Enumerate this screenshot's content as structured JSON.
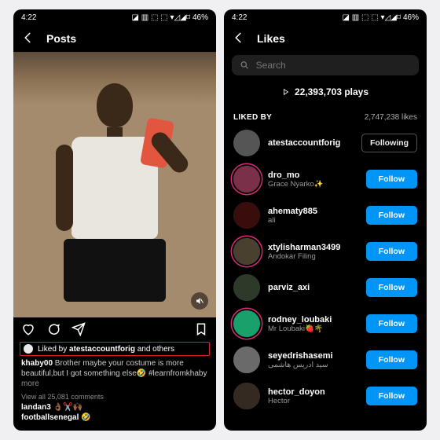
{
  "status": {
    "time": "4:22",
    "battery": "46%",
    "net_icons": "◪ ▥ ⬚ ⬚ ▾◿◢⌑"
  },
  "left": {
    "header_title": "Posts",
    "liked_prefix": "Liked by ",
    "liked_user": "atestaccountforig",
    "liked_suffix": " and others",
    "caption_user": "khaby00",
    "caption_text": " Brother maybe your costume is more beautiful,but I got something else🤣 #learnfromkhaby ",
    "more": "more",
    "view_comments": "View all 25,081 comments",
    "comment1_user": "landan3",
    "comment1_text": " 👌🏾✂️🙌🏾",
    "comment2_user": "footballsenegal",
    "comment2_text": " 🤣"
  },
  "right": {
    "header_title": "Likes",
    "search_placeholder": "Search",
    "plays": "22,393,703 plays",
    "liked_by_label": "LIKED BY",
    "likes_count": "2,747,238 likes",
    "following_label": "Following",
    "follow_label": "Follow",
    "users": [
      {
        "username": "atestaccountforig",
        "sub": "",
        "btn": "following",
        "avatar": "grey"
      },
      {
        "username": "dro_mo",
        "sub": "Grace Nyarko✨",
        "btn": "follow",
        "avatar": "ring",
        "tint": "#7a3048"
      },
      {
        "username": "ahematy885",
        "sub": "ali",
        "btn": "follow",
        "avatar": "",
        "tint": "#3a0d0d"
      },
      {
        "username": "xtylisharman3499",
        "sub": "Andokar Filing",
        "btn": "follow",
        "avatar": "ring",
        "tint": "#4a4030"
      },
      {
        "username": "parviz_axi",
        "sub": "",
        "btn": "follow",
        "avatar": "",
        "tint": "#2d3a2a"
      },
      {
        "username": "rodney_loubaki",
        "sub": "Mr Loubaki🍓🌴",
        "btn": "follow",
        "avatar": "ring",
        "tint": "#1aa06a"
      },
      {
        "username": "seyedrishasemi",
        "sub": "سید ادریس هاشمی",
        "btn": "follow",
        "avatar": "",
        "tint": "#6a6a6a"
      },
      {
        "username": "hector_doyon",
        "sub": "Hector",
        "btn": "follow",
        "avatar": "",
        "tint": "#342a22"
      }
    ]
  }
}
